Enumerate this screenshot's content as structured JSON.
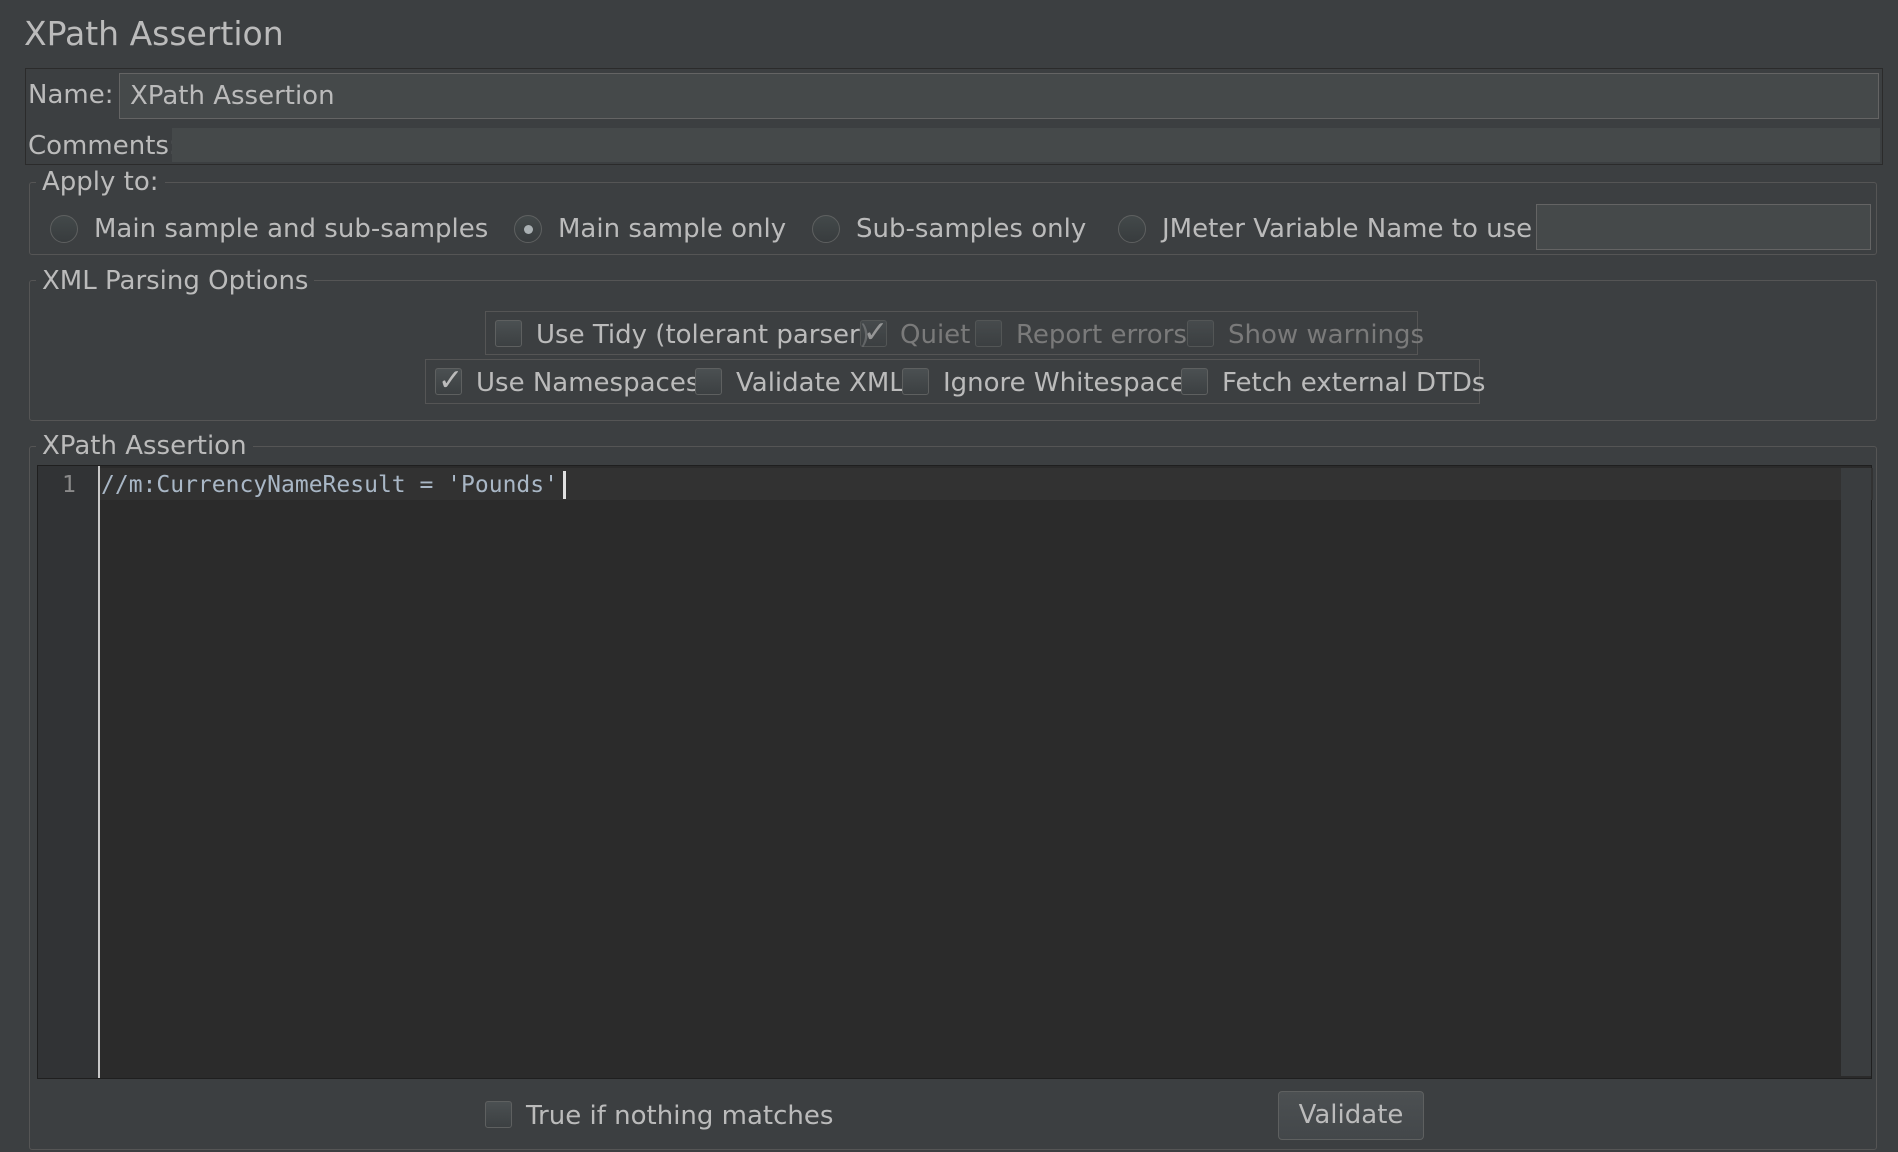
{
  "title": "XPath Assertion",
  "name_label": "Name:",
  "name_value": "XPath Assertion",
  "comments_label": "Comments:",
  "comments_value": "",
  "apply_to": {
    "legend": "Apply to:",
    "options": [
      {
        "label": "Main sample and sub-samples",
        "selected": false
      },
      {
        "label": "Main sample only",
        "selected": true
      },
      {
        "label": "Sub-samples only",
        "selected": false
      },
      {
        "label": "JMeter Variable Name to use",
        "selected": false
      }
    ],
    "variable_name_value": ""
  },
  "xml_parsing": {
    "legend": "XML Parsing Options",
    "row1": [
      {
        "label": "Use Tidy (tolerant parser)",
        "checked": false,
        "enabled": true
      },
      {
        "label": "Quiet",
        "checked": true,
        "enabled": false
      },
      {
        "label": "Report errors",
        "checked": false,
        "enabled": false
      },
      {
        "label": "Show warnings",
        "checked": false,
        "enabled": false
      }
    ],
    "row2": [
      {
        "label": "Use Namespaces",
        "checked": true,
        "enabled": true
      },
      {
        "label": "Validate XML",
        "checked": false,
        "enabled": true
      },
      {
        "label": "Ignore Whitespace",
        "checked": false,
        "enabled": true
      },
      {
        "label": "Fetch external DTDs",
        "checked": false,
        "enabled": true
      }
    ]
  },
  "xpath": {
    "legend": "XPath Assertion",
    "line_number": "1",
    "code": "//m:CurrencyNameResult = 'Pounds'"
  },
  "footer": {
    "true_if_nothing_matches_label": "True if nothing matches",
    "true_if_nothing_matches_checked": false,
    "validate_button": "Validate"
  }
}
